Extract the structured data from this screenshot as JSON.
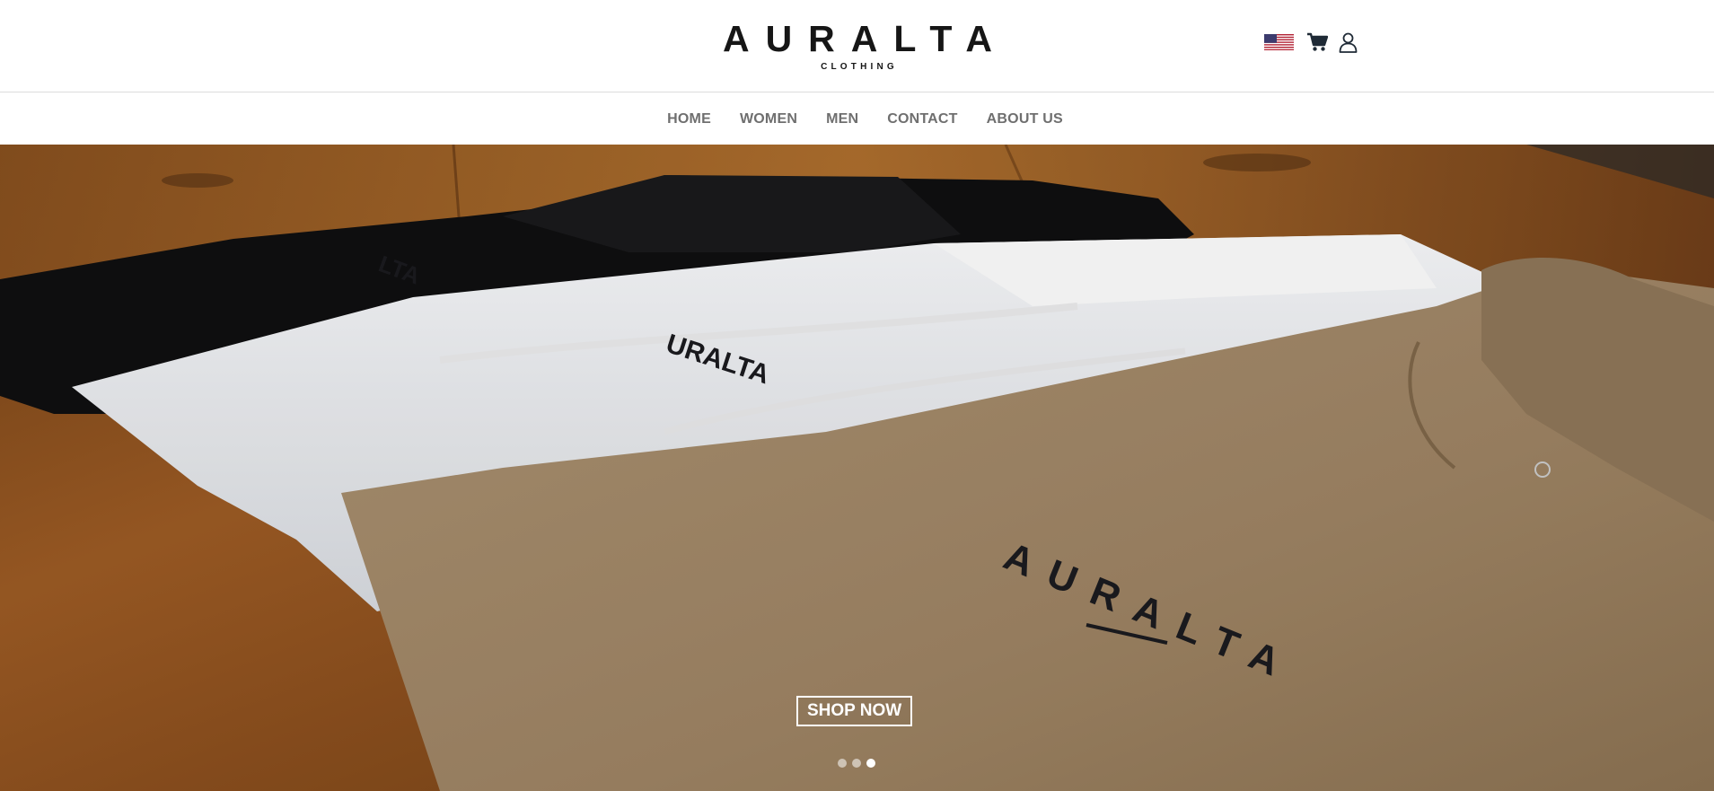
{
  "brand": {
    "name": "AURALTA",
    "tagline": "CLOTHING"
  },
  "header": {
    "flag_icon": "us-flag-icon",
    "cart_icon": "shopping-cart-icon",
    "account_icon": "user-icon"
  },
  "nav": {
    "items": [
      {
        "label": "HOME"
      },
      {
        "label": "WOMEN"
      },
      {
        "label": "MEN"
      },
      {
        "label": "CONTACT"
      },
      {
        "label": "ABOUT US"
      }
    ]
  },
  "hero": {
    "cta_label": "SHOP NOW",
    "slide_count": 3,
    "active_slide": 3,
    "print_text": "AURALTA"
  },
  "colors": {
    "nav_text": "#6f6f6f",
    "brand_text": "#161616",
    "cta_border": "#ffffff"
  }
}
